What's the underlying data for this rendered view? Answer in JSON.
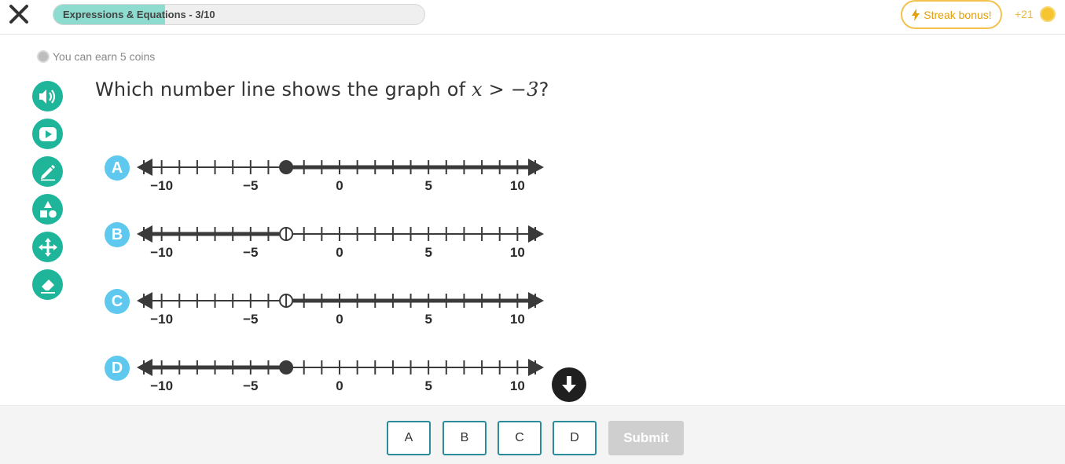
{
  "header": {
    "progress_label": "Expressions & Equations - 3/10",
    "progress_fraction": 0.3,
    "streak_label": "Streak bonus!",
    "coins_label": "+21"
  },
  "earn": {
    "text": "You can earn 5 coins"
  },
  "tools": [
    "audio-icon",
    "video-icon",
    "pencil-icon",
    "shapes-icon",
    "move-icon",
    "eraser-icon"
  ],
  "question": {
    "prefix": "Which number line shows the graph of ",
    "math": "x > −3",
    "suffix": "?"
  },
  "options": [
    {
      "letter": "A",
      "point": -3,
      "closed": true,
      "direction": "right"
    },
    {
      "letter": "B",
      "point": -3,
      "closed": false,
      "direction": "left"
    },
    {
      "letter": "C",
      "point": -3,
      "closed": false,
      "direction": "right"
    },
    {
      "letter": "D",
      "point": -3,
      "closed": true,
      "direction": "left"
    }
  ],
  "number_line": {
    "min": -11,
    "max": 11,
    "tick_labels": [
      "−10",
      "−5",
      "0",
      "5",
      "10"
    ]
  },
  "answer_buttons": [
    "A",
    "B",
    "C",
    "D"
  ],
  "submit_label": "Submit",
  "colors": {
    "accent": "#1fb59b",
    "badge": "#5ec8ef",
    "streak": "#e3a008",
    "line": "#3a3a3a"
  }
}
